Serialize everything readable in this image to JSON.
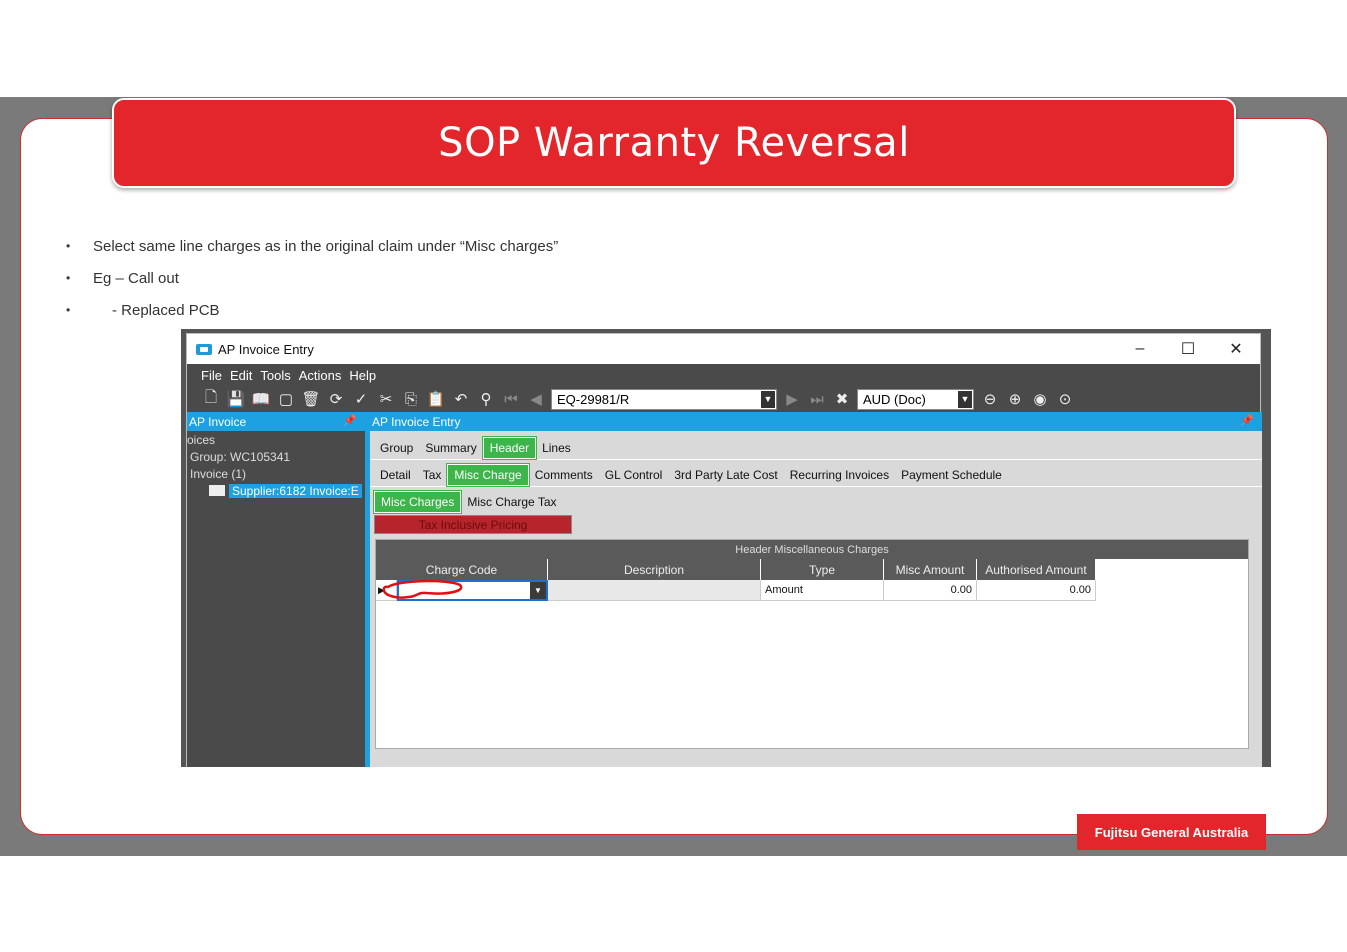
{
  "slide": {
    "title": "SOP Warranty Reversal",
    "bullets": [
      "Select same line charges as in the original claim under “Misc charges”",
      "Eg – Call out",
      "  - Replaced PCB"
    ],
    "footer": "Fujitsu General Australia"
  },
  "app": {
    "window_title": "AP Invoice Entry",
    "menu": [
      "File",
      "Edit",
      "Tools",
      "Actions",
      "Help"
    ],
    "record_combo": "EQ-29981/R",
    "currency_combo": "AUD (Doc)",
    "left_pane": {
      "header": "AP Invoice",
      "tree": [
        "oices",
        "Group: WC105341",
        "Invoice (1)",
        "Supplier:6182 Invoice:E"
      ]
    },
    "right_pane": {
      "header": "AP Invoice Entry",
      "tabs_level1": [
        "Group",
        "Summary",
        "Header",
        "Lines"
      ],
      "tabs_level2": [
        "Detail",
        "Tax",
        "Misc Charge",
        "Comments",
        "GL Control",
        "3rd Party Late Cost",
        "Recurring Invoices",
        "Payment Schedule"
      ],
      "tabs_level3": [
        "Misc Charges",
        "Misc Charge Tax"
      ],
      "tax_inclusive": "Tax Inclusive Pricing",
      "grid": {
        "title": "Header Miscellaneous Charges",
        "columns": [
          "Charge Code",
          "Description",
          "Type",
          "Misc Amount",
          "Authorised Amount"
        ],
        "rows": [
          {
            "charge_code": "",
            "description": "",
            "type": "Amount",
            "misc_amount": "0.00",
            "authorised_amount": "0.00"
          }
        ]
      }
    },
    "colors": {
      "accent": "#1ea1e0",
      "active_tab": "#3cb54a",
      "brand_red": "#e3262b"
    }
  }
}
